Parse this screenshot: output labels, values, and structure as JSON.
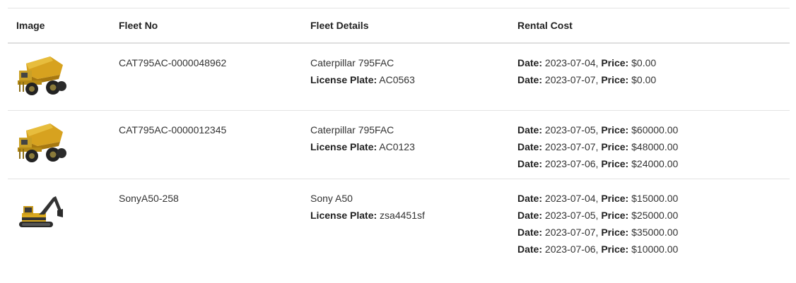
{
  "table": {
    "headers": {
      "image": "Image",
      "fleet_no": "Fleet No",
      "fleet_details": "Fleet Details",
      "rental_cost": "Rental Cost"
    },
    "labels": {
      "license_plate": "License Plate:",
      "date": "Date:",
      "price": "Price:"
    },
    "rows": [
      {
        "image_icon": "mining-dump-truck-icon",
        "fleet_no": "CAT795AC-0000048962",
        "model": "Caterpillar 795FAC",
        "license_plate": "AC0563",
        "rentals": [
          {
            "date": "2023-07-04,",
            "price": "$0.00"
          },
          {
            "date": "2023-07-07,",
            "price": "$0.00"
          }
        ]
      },
      {
        "image_icon": "mining-dump-truck-icon",
        "fleet_no": "CAT795AC-0000012345",
        "model": "Caterpillar 795FAC",
        "license_plate": "AC0123",
        "rentals": [
          {
            "date": "2023-07-05,",
            "price": "$60000.00"
          },
          {
            "date": "2023-07-07,",
            "price": "$48000.00"
          },
          {
            "date": "2023-07-06,",
            "price": "$24000.00"
          }
        ]
      },
      {
        "image_icon": "excavator-icon",
        "fleet_no": "SonyA50-258",
        "model": "Sony A50",
        "license_plate": "zsa4451sf",
        "rentals": [
          {
            "date": "2023-07-04,",
            "price": "$15000.00"
          },
          {
            "date": "2023-07-05,",
            "price": "$25000.00"
          },
          {
            "date": "2023-07-07,",
            "price": "$35000.00"
          },
          {
            "date": "2023-07-06,",
            "price": "$10000.00"
          }
        ]
      }
    ]
  }
}
